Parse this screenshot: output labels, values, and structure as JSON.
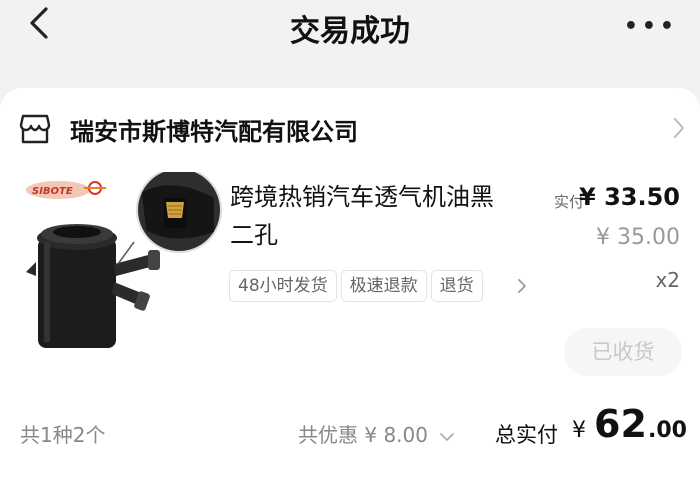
{
  "header": {
    "title": "交易成功",
    "more_icon": "more-dots-icon",
    "back_icon": "back-chevron-icon"
  },
  "shop": {
    "icon": "shop-icon",
    "name": "瑞安市斯博特汽配有限公司"
  },
  "product": {
    "name": "跨境热销汽车透气机油黑 二孔",
    "paid_label": "实付",
    "paid_price": "¥ 33.50",
    "original_price": "¥ 35.00",
    "quantity": "x2",
    "tags": [
      "48小时发货",
      "极速退款",
      "退货"
    ],
    "status_button": "已收货",
    "image_brand_text": "SIBOTE"
  },
  "summary": {
    "count_text": "共1种2个",
    "discount_text": "共优惠 ¥ 8.00",
    "total_label": "总实付",
    "total_currency": "¥",
    "total_int": "62",
    "total_dec": ".00"
  },
  "colors": {
    "page_bg": "#f2f2f2",
    "card_bg": "#ffffff",
    "muted": "#888888",
    "disabled_button_text": "#c8c8c8"
  }
}
